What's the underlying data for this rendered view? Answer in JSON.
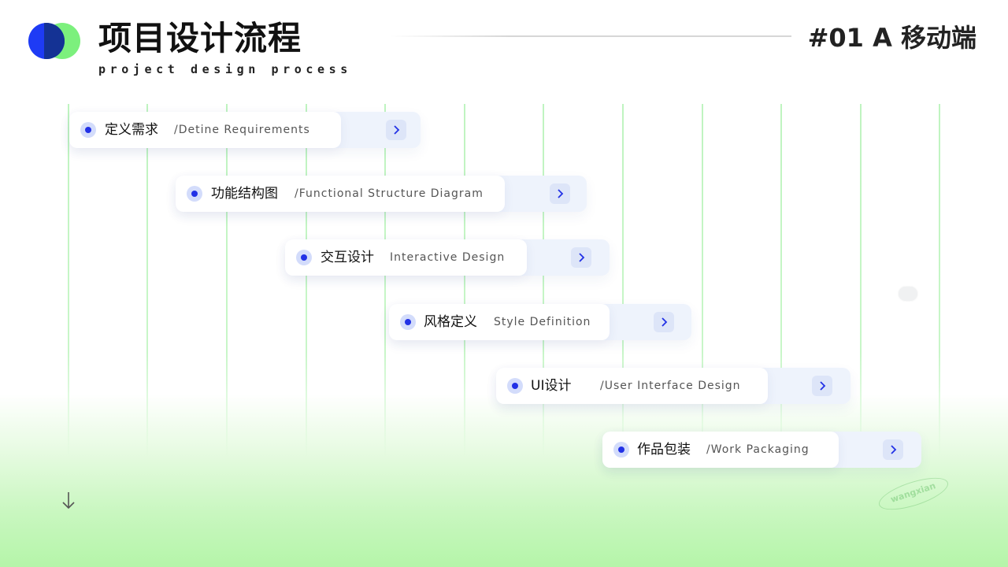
{
  "header": {
    "title": "项目设计流程",
    "subtitle": "project design process",
    "page_tag": "#01  A 移动端"
  },
  "colors": {
    "accent_blue": "#2231e6",
    "accent_green": "#7cf07d",
    "grid_line": "#bff4c0",
    "card_bg": "#eef3fc"
  },
  "steps": [
    {
      "cn": "定义需求",
      "en": "/Detine Requirements",
      "icon": "chevron-right-icon"
    },
    {
      "cn": "功能结构图",
      "en": "/Functional Structure Diagram",
      "icon": "chevron-right-icon"
    },
    {
      "cn": "交互设计",
      "en": "Interactive Design",
      "icon": "chevron-right-icon"
    },
    {
      "cn": "风格定义",
      "en": "Style Definition",
      "icon": "chevron-right-icon"
    },
    {
      "cn": "UI设计",
      "en": "/User Interface Design",
      "icon": "chevron-right-icon"
    },
    {
      "cn": "作品包装",
      "en": "/Work Packaging",
      "icon": "chevron-right-icon"
    }
  ],
  "footer": {
    "scroll_icon": "arrow-down-icon",
    "watermark": "wangxian"
  }
}
